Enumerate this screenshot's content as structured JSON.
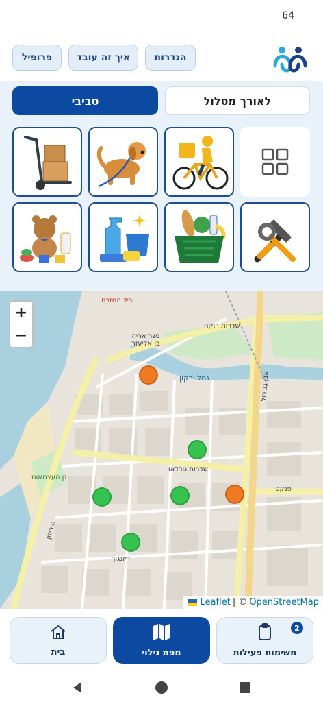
{
  "status": {
    "time": "64"
  },
  "header": {
    "buttons": [
      {
        "label": "הגדרות"
      },
      {
        "label": "איך זה עובד"
      },
      {
        "label": "פרופיל"
      }
    ]
  },
  "mode": {
    "active_label": "סביבי",
    "inactive_label": "לאורך מסלול"
  },
  "categories": [
    {
      "icon": "grid-icon"
    },
    {
      "icon": "delivery-cyclist-icon"
    },
    {
      "icon": "dog-icon"
    },
    {
      "icon": "hand-truck-icon"
    },
    {
      "icon": "tools-icon"
    },
    {
      "icon": "grocery-basket-icon"
    },
    {
      "icon": "cleaning-supplies-icon"
    },
    {
      "icon": "baby-toys-icon"
    }
  ],
  "map": {
    "zoom_in": "+",
    "zoom_out": "−",
    "attribution": {
      "leaflet": "Leaflet",
      "separator": "| ©",
      "osm": "OpenStreetMap"
    },
    "labels": {
      "l1": "שדרות רוקח",
      "l2": "נשר אריה בן אליעזר",
      "l3": "נחל ירקון",
      "l4": "שדרות נורדאו",
      "l5": "פנקס",
      "l6": "אבן גבירול",
      "l7": "דיזנגוף",
      "l8": "הירקון",
      "l9": "גן העצמאות",
      "l10": "יריד המזרח"
    },
    "markers": [
      {
        "color": "#f07a22",
        "status": "orange"
      },
      {
        "color": "#35c24f",
        "status": "green"
      },
      {
        "color": "#35c24f",
        "status": "green"
      },
      {
        "color": "#35c24f",
        "status": "green"
      },
      {
        "color": "#f07a22",
        "status": "orange"
      },
      {
        "color": "#35c24f",
        "status": "green"
      }
    ]
  },
  "bottom_nav": {
    "tasks": {
      "label": "משימות פעילות",
      "badge": "2"
    },
    "map": {
      "label": "מפת גילוי"
    },
    "home": {
      "label": "בית"
    }
  },
  "colors": {
    "primary": "#0b4aa0",
    "light": "#e9f2fb",
    "orange": "#f07a22",
    "green": "#35c24f"
  }
}
